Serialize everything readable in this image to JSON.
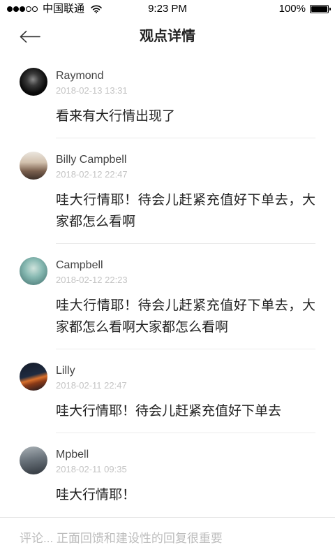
{
  "status_bar": {
    "carrier": "中国联通",
    "signal_level": 3,
    "signal_max": 5,
    "time": "9:23 PM",
    "battery_text": "100%",
    "battery_level": 1.0
  },
  "icons": {
    "signal": "signal-strength-icon",
    "wifi": "wifi-icon",
    "battery": "battery-icon",
    "back": "back-arrow-icon"
  },
  "nav": {
    "title": "观点详情"
  },
  "comments": [
    {
      "name": "Raymond",
      "date": "2018-02-13 13:31",
      "content": "看来有大行情出现了"
    },
    {
      "name": "Billy Campbell",
      "date": "2018-02-12 22:47",
      "content": "哇大行情耶！待会儿赶紧充值好下单去，大家都怎么看啊"
    },
    {
      "name": "Campbell",
      "date": "2018-02-12 22:23",
      "content": "哇大行情耶！待会儿赶紧充值好下单去，大家都怎么看啊大家都怎么看啊"
    },
    {
      "name": "Lilly",
      "date": "2018-02-11 22:47",
      "content": "哇大行情耶！待会儿赶紧充值好下单去"
    },
    {
      "name": "Mpbell",
      "date": "2018-02-11 09:35",
      "content": "哇大行情耶！"
    }
  ],
  "comment_bar": {
    "placeholder": "评论... 正面回馈和建设性的回复很重要"
  }
}
